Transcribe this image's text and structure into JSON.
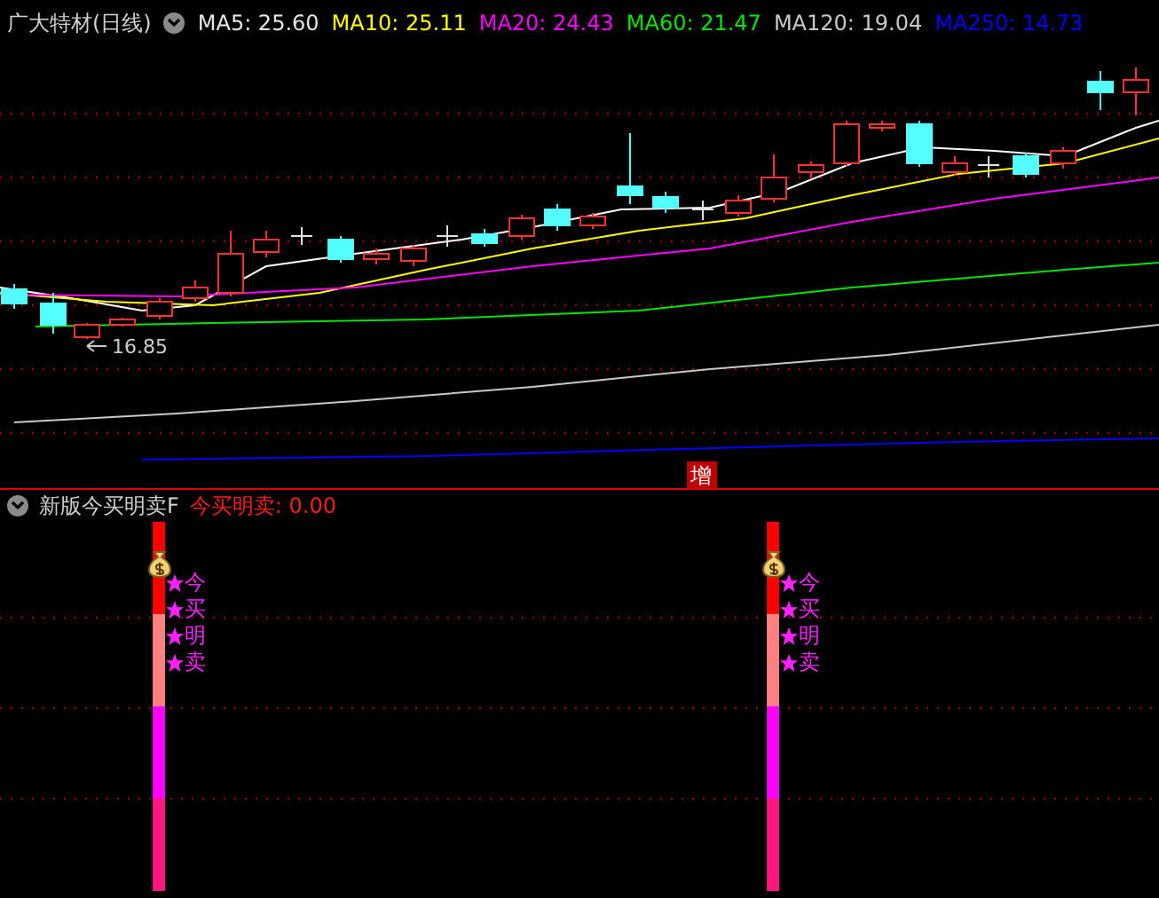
{
  "header": {
    "title": "广大特材(日线)",
    "indicators": [
      {
        "label": "MA5: 25.60",
        "color": "#e6e6e6"
      },
      {
        "label": "MA10: 25.11",
        "color": "#ffff00"
      },
      {
        "label": "MA20: 24.43",
        "color": "#ff00ff"
      },
      {
        "label": "MA60: 21.47",
        "color": "#00e600"
      },
      {
        "label": "MA120: 19.04",
        "color": "#c8c8c8"
      },
      {
        "label": "MA250: 14.73",
        "color": "#0000ff"
      }
    ]
  },
  "chart": {
    "low_label": "16.85",
    "marker": "增"
  },
  "sub_panel": {
    "title": "新版今买明卖F",
    "value_label": "今买明卖: 0.00",
    "signals": [
      {
        "chars": [
          "今",
          "买",
          "明",
          "卖"
        ]
      },
      {
        "chars": [
          "今",
          "买",
          "明",
          "卖"
        ]
      }
    ]
  }
}
